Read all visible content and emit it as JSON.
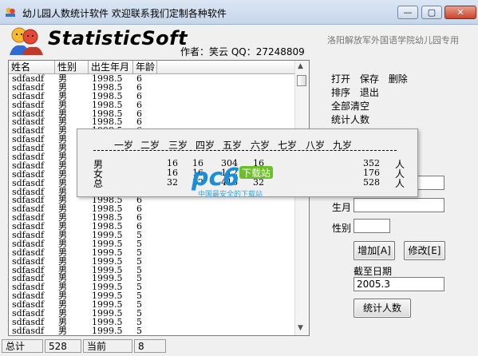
{
  "window": {
    "title": "幼儿园人数统计软件   欢迎联系我们定制各种软件",
    "minimize": "—",
    "maximize": "▢",
    "close": "✕"
  },
  "header": {
    "app_name": "StatisticSoft",
    "author": "作者：笑云  QQ：27248809",
    "school": "洛阳解放军外国语学院幼儿园专用"
  },
  "list": {
    "columns": [
      "姓名",
      "性别",
      "出生年月",
      "年龄"
    ],
    "rows": [
      [
        "sdfasdf",
        "男",
        "1998.5",
        "6"
      ],
      [
        "sdfasdf",
        "男",
        "1998.5",
        "6"
      ],
      [
        "sdfasdf",
        "男",
        "1998.5",
        "6"
      ],
      [
        "sdfasdf",
        "男",
        "1998.5",
        "6"
      ],
      [
        "sdfasdf",
        "男",
        "1998.5",
        "6"
      ],
      [
        "sdfasdf",
        "男",
        "1998.5",
        "6"
      ],
      [
        "sdfasdf",
        "男",
        "1998.5",
        "6"
      ],
      [
        "sdfasdf",
        "男",
        "1998.5",
        "6"
      ],
      [
        "sdfasdf",
        "男",
        "1998.5",
        "6"
      ],
      [
        "sdfasdf",
        "男",
        "1998.5",
        "6"
      ],
      [
        "sdfasdf",
        "男",
        "1998.5",
        "6"
      ],
      [
        "sdfasdf",
        "男",
        "1998.5",
        "6"
      ],
      [
        "sdfasdf",
        "男",
        "1998.5",
        "6"
      ],
      [
        "sdfasdf",
        "男",
        "1998.5",
        "6"
      ],
      [
        "sdfasdf",
        "男",
        "1998.5",
        "6"
      ],
      [
        "sdfasdf",
        "男",
        "1998.5",
        "6"
      ],
      [
        "sdfasdf",
        "男",
        "1998.5",
        "6"
      ],
      [
        "sdfasdf",
        "男",
        "1998.5",
        "6"
      ],
      [
        "sdfasdf",
        "男",
        "1999.5",
        "5"
      ],
      [
        "sdfasdf",
        "男",
        "1999.5",
        "5"
      ],
      [
        "sdfasdf",
        "男",
        "1999.5",
        "5"
      ],
      [
        "sdfasdf",
        "男",
        "1999.5",
        "5"
      ],
      [
        "sdfasdf",
        "男",
        "1999.5",
        "5"
      ],
      [
        "sdfasdf",
        "男",
        "1999.5",
        "5"
      ],
      [
        "sdfasdf",
        "男",
        "1999.5",
        "5"
      ],
      [
        "sdfasdf",
        "男",
        "1999.5",
        "5"
      ],
      [
        "sdfasdf",
        "男",
        "1999.5",
        "5"
      ],
      [
        "sdfasdf",
        "男",
        "1999.5",
        "5"
      ],
      [
        "sdfasdf",
        "男",
        "1999.5",
        "5"
      ],
      [
        "sdfasdf",
        "男",
        "1999.5",
        "5"
      ]
    ]
  },
  "status": {
    "total_label": "总计",
    "total_value": "528",
    "current_label": "当前",
    "current_value": "8"
  },
  "menu": {
    "line1": [
      "打开",
      "保存",
      "删除"
    ],
    "line2": [
      "排序",
      "退出"
    ],
    "line3": "全部清空",
    "line4": "统计人数"
  },
  "form": {
    "birth_label": "生月",
    "gender_label": "性别",
    "add_button": "增加[A]",
    "edit_button": "修改[E]",
    "cutoff_label": "截至日期",
    "cutoff_value": "2005.3",
    "count_button": "统计人数"
  },
  "popup": {
    "age_headers": [
      "一岁",
      "二岁",
      "三岁",
      "四岁",
      "五岁",
      "六岁",
      "七岁",
      "八岁",
      "九岁"
    ],
    "rows": [
      {
        "label": "男",
        "values": [
          "16",
          "16",
          "304",
          "16"
        ],
        "total": "352",
        "unit": "人"
      },
      {
        "label": "女",
        "values": [
          "16",
          "16",
          "112",
          "16"
        ],
        "total": "176",
        "unit": "人"
      },
      {
        "label": "总",
        "values": [
          "32",
          "32",
          "416",
          "32"
        ],
        "total": "528",
        "unit": "人"
      }
    ]
  },
  "watermark": {
    "brand": "pc6",
    "suffix": "下载站",
    "tagline": "中国最安全的下载站",
    "colors": {
      "blue": "#1a8fd8",
      "green": "#6cbf2a"
    }
  }
}
